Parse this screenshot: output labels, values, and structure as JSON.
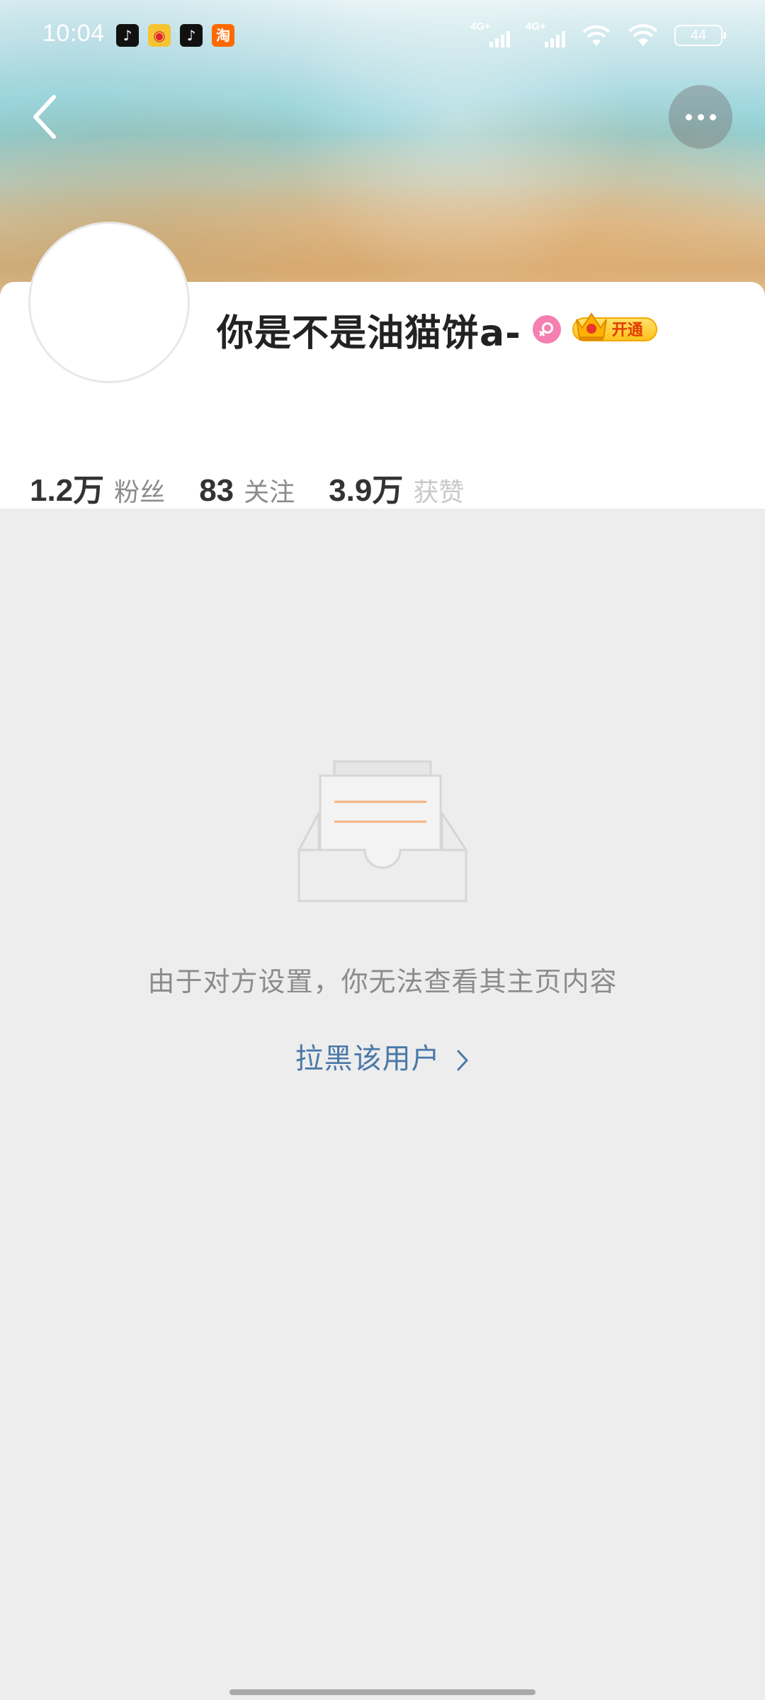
{
  "status_bar": {
    "time": "10:04",
    "notification_apps": [
      "tiktok-icon",
      "weibo-icon",
      "tiktok-icon",
      "taobao-icon"
    ],
    "network_1": "4G+",
    "network_2": "4G+",
    "battery": "44"
  },
  "profile": {
    "username": "你是不是油猫饼a-",
    "vip_label": "开通",
    "stats": [
      {
        "value": "1.2万",
        "label": "粉丝"
      },
      {
        "value": "83",
        "label": "关注"
      },
      {
        "value": "3.9万",
        "label": "获赞"
      }
    ]
  },
  "empty_state": {
    "message": "由于对方设置，你无法查看其主页内容",
    "action": "拉黑该用户"
  },
  "colors": {
    "link": "#4a78a8",
    "gender_female": "#f57fb0",
    "vip_gold": "#ffc21b",
    "illustration_line": "#f5b183"
  }
}
